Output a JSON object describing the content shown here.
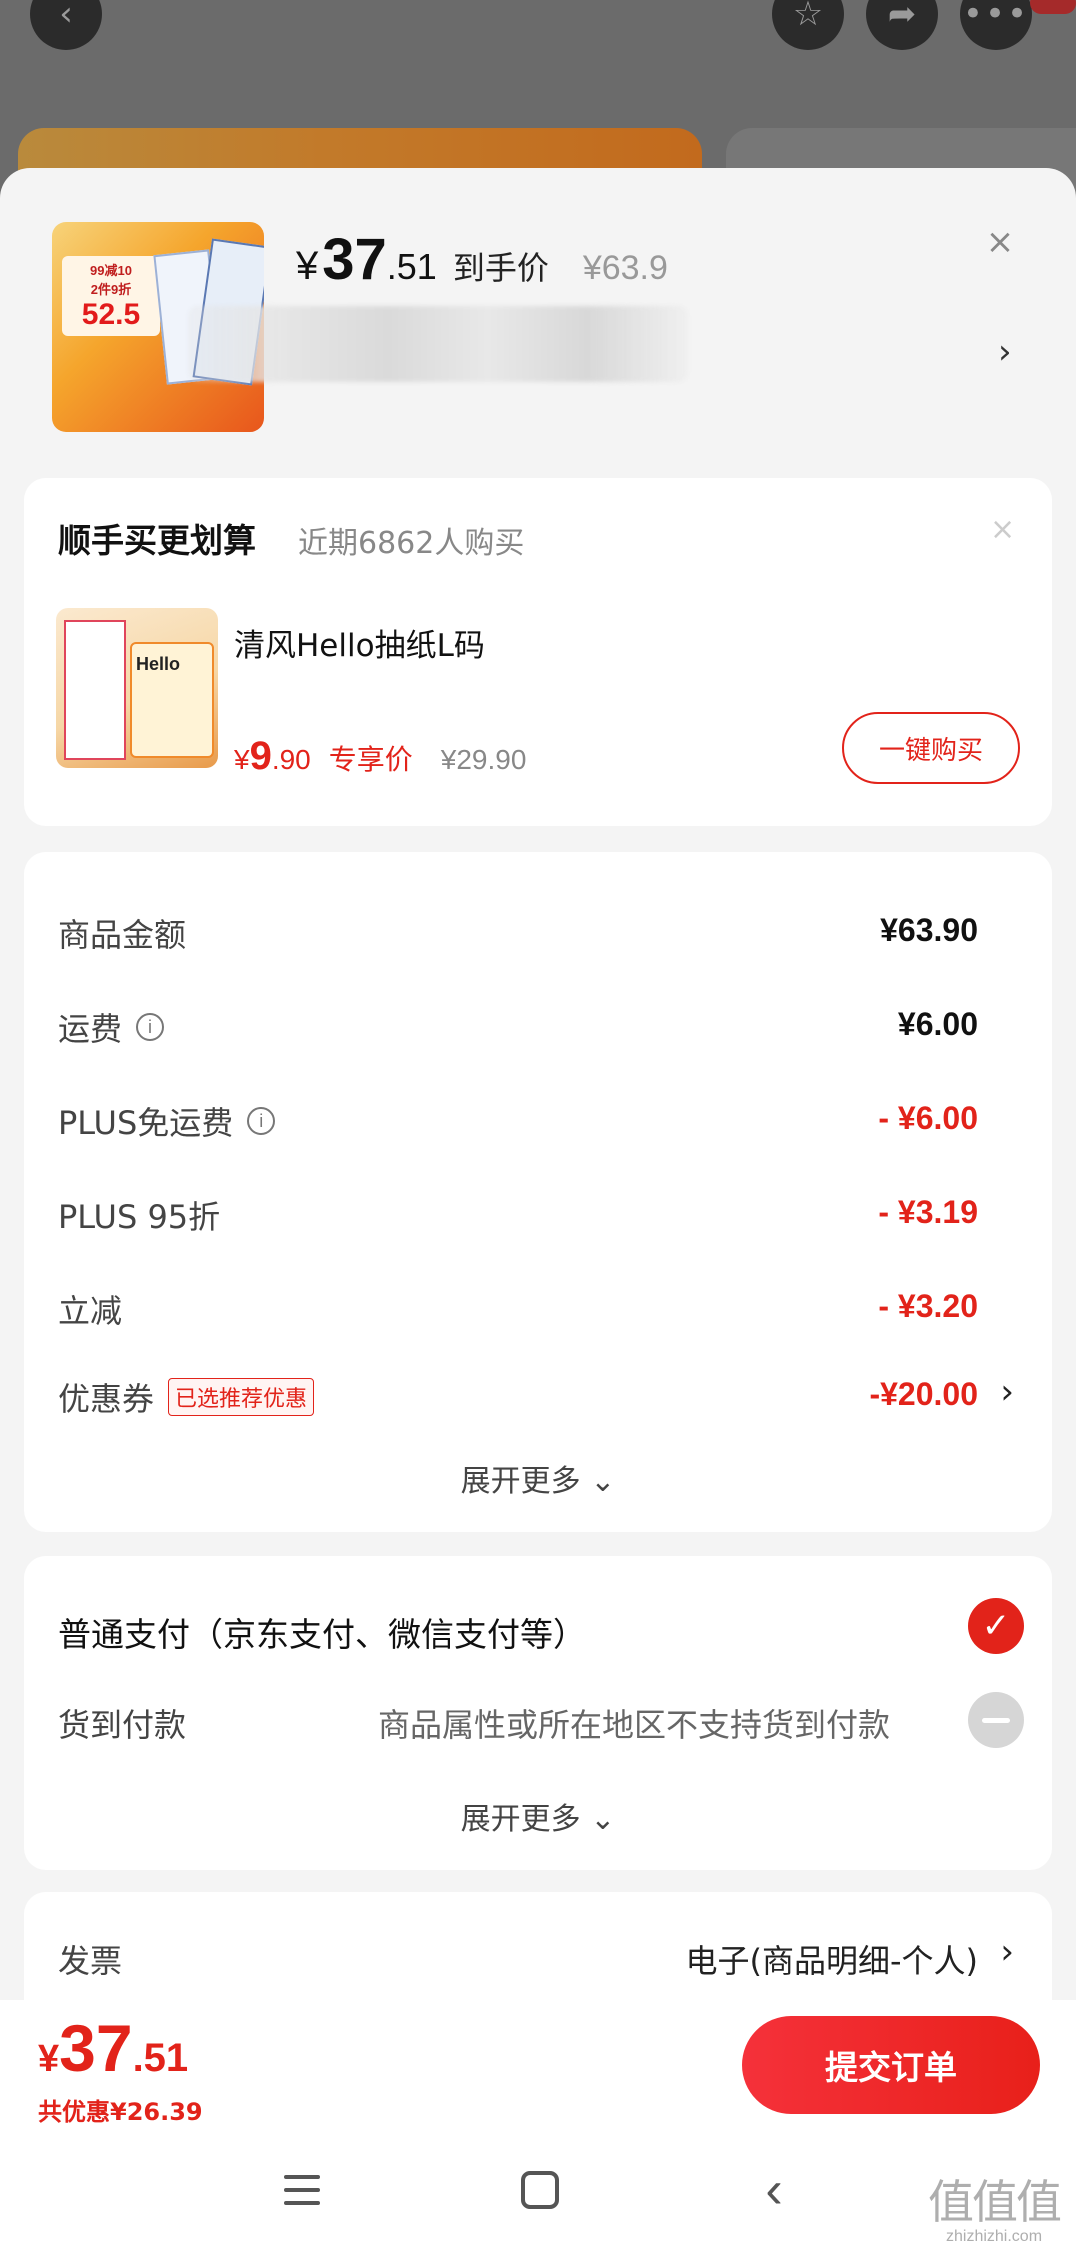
{
  "background": {
    "back_icon": "chevron-left-icon",
    "favorite_icon": "star-icon",
    "share_icon": "share-icon",
    "more_icon": "more-dots-icon"
  },
  "product": {
    "currency": "¥",
    "price_int": "37",
    "price_dec": ".51",
    "price_label": "到手价",
    "original_price": "¥63.9",
    "thumb_tag_line1": "99减10",
    "thumb_tag_line2": "2件9折",
    "thumb_tag_price": "52.5"
  },
  "upsell": {
    "title": "顺手买更划算",
    "subtitle": "近期6862人购买",
    "item_name": "清风Hello抽纸L码",
    "thumb_label": "Hello",
    "price_currency": "¥",
    "price_int": "9",
    "price_dec": ".90",
    "price_label": "专享价",
    "original_price": "¥29.90",
    "buy_label": "一键购买"
  },
  "amounts": {
    "rows": [
      {
        "label": "商品金额",
        "value": "¥63.90"
      },
      {
        "label": "运费",
        "value": "¥6.00"
      },
      {
        "label": "PLUS免运费",
        "value": "- ¥6.00"
      },
      {
        "label": "PLUS 95折",
        "value": "- ¥3.19"
      },
      {
        "label": "立减",
        "value": "- ¥3.20"
      },
      {
        "label": "优惠券",
        "value": "-¥20.00",
        "tag": "已选推荐优惠"
      }
    ],
    "expand_label": "展开更多 ⌄"
  },
  "payment": {
    "normal_label": "普通支付（京东支付、微信支付等）",
    "cod_label": "货到付款",
    "cod_note": "商品属性或所在地区不支持货到付款",
    "expand_label": "展开更多 ⌄"
  },
  "invoice": {
    "label": "发票",
    "value": "电子(商品明细-个人)"
  },
  "bottom": {
    "currency": "¥",
    "price_int": "37",
    "price_dec": ".51",
    "savings": "共优惠¥26.39",
    "submit_label": "提交订单"
  },
  "watermark": {
    "glyphs": "值值值",
    "domain": "zhizhizhi.com"
  },
  "colors": {
    "accent": "#e2231a",
    "muted": "#888888"
  }
}
